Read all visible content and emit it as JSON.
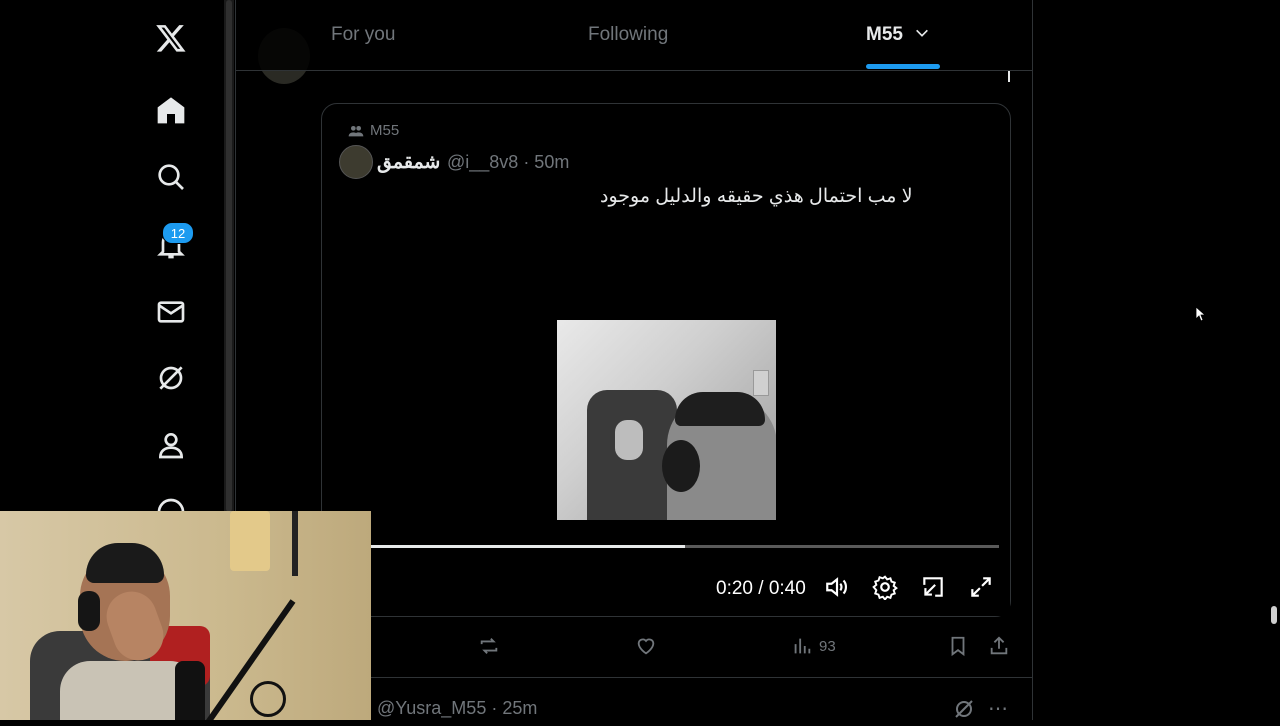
{
  "tabs": {
    "for_you": "For you",
    "following": "Following",
    "list": "M55"
  },
  "sidebar": {
    "notifications_badge": "12"
  },
  "quoted_post": {
    "community": "M55",
    "display_name": "شمقمق",
    "handle_time": "@i__8v8 · 50m",
    "text": "لا مب احتمال هذي حقيقه والدليل موجود"
  },
  "video": {
    "time": "0:20 / 0:40",
    "progress": 0.5
  },
  "actions": {
    "views": "93"
  },
  "next_post": {
    "handle_time": "@Yusra_M55 · 25m"
  },
  "colors": {
    "accent": "#1d9bf0",
    "muted": "#71767b",
    "border": "#2f3336"
  }
}
